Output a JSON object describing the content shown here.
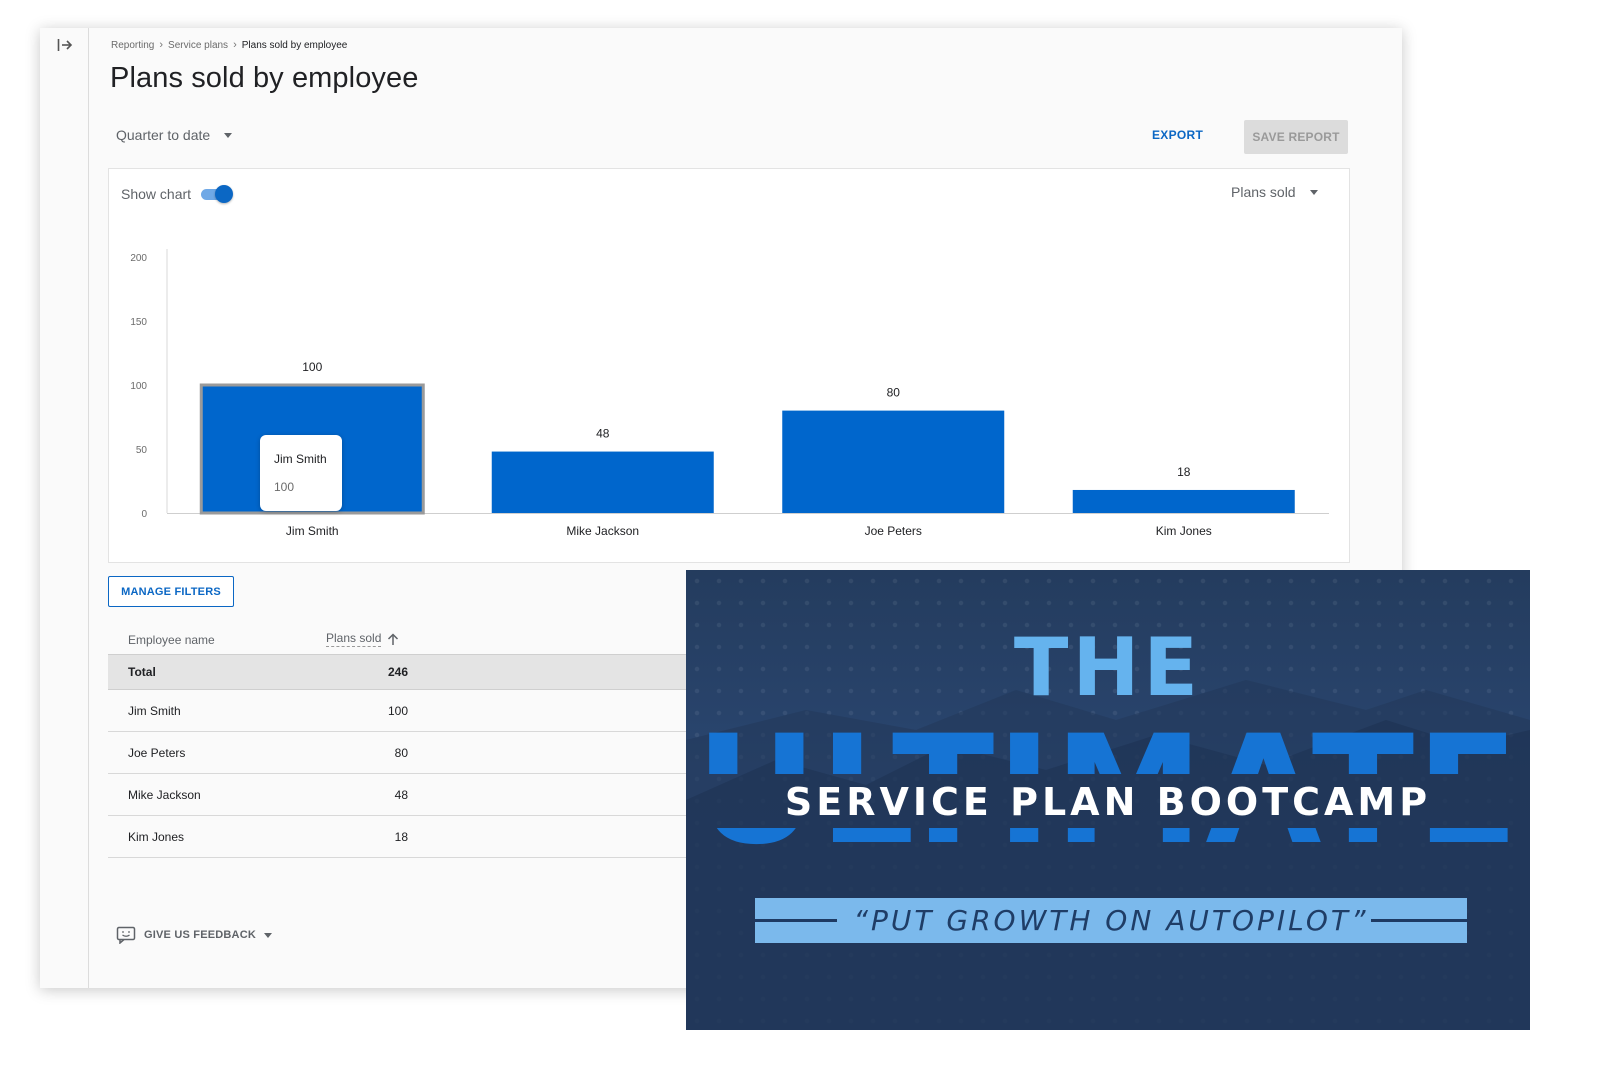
{
  "breadcrumb": {
    "items": [
      "Reporting",
      "Service plans"
    ],
    "current": "Plans sold by employee"
  },
  "page": {
    "title": "Plans sold by employee"
  },
  "controls": {
    "date_range": "Quarter to date",
    "export_label": "EXPORT",
    "save_report_label": "SAVE REPORT",
    "show_chart_label": "Show chart",
    "show_chart_on": true,
    "metric_select": "Plans sold"
  },
  "chart_data": {
    "type": "bar",
    "categories": [
      "Jim Smith",
      "Mike Jackson",
      "Joe Peters",
      "Kim Jones"
    ],
    "values": [
      100,
      48,
      80,
      18
    ],
    "y_ticks": [
      0,
      50,
      100,
      150,
      200
    ],
    "ylim": [
      0,
      200
    ],
    "bar_color": "#0066cc",
    "highlighted": "Jim Smith",
    "title": "",
    "xlabel": "",
    "ylabel": ""
  },
  "tooltip": {
    "name": "Jim Smith",
    "value": "100"
  },
  "filters": {
    "manage_label": "MANAGE FILTERS"
  },
  "table": {
    "headers": {
      "name": "Employee name",
      "sold": "Plans sold"
    },
    "total": {
      "name": "Total",
      "value": "246"
    },
    "rows": [
      {
        "name": "Jim Smith",
        "value": "100"
      },
      {
        "name": "Joe Peters",
        "value": "80"
      },
      {
        "name": "Mike Jackson",
        "value": "48"
      },
      {
        "name": "Kim Jones",
        "value": "18"
      }
    ]
  },
  "feedback": {
    "label": "GIVE US FEEDBACK"
  },
  "promo": {
    "line1": "THE",
    "line2": "ULTIMATE",
    "subtitle": "SERVICE PLAN BOOTCAMP",
    "tagline": "“PUT GROWTH ON AUTOPILOT”"
  },
  "colors": {
    "accent": "#0b67c4",
    "bar": "#0066cc",
    "promo_light": "#65b3ee",
    "promo_mid": "#1674d4",
    "promo_bg": "#2a4670"
  },
  "icons": {
    "rail": "collapse-sidebar-icon",
    "sort": "arrow-up-icon",
    "feedback": "feedback-icon"
  }
}
